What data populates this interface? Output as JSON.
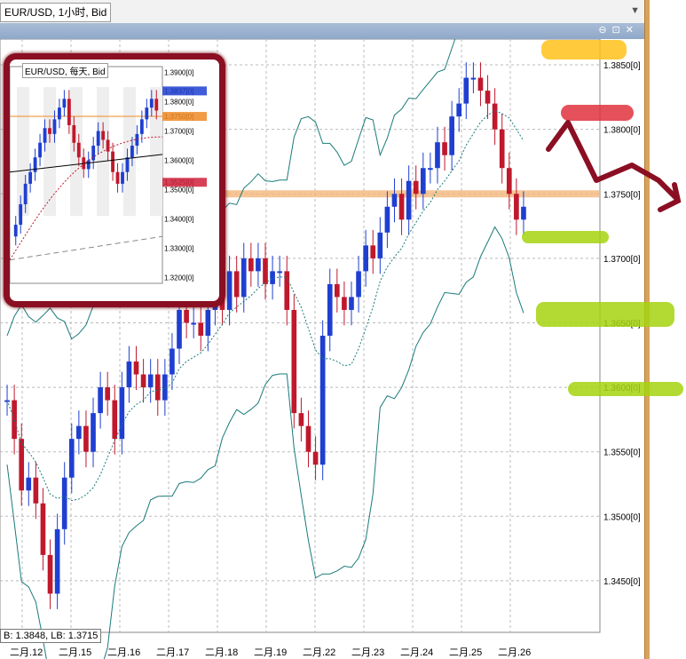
{
  "window": {
    "symbol_tab": "EUR/USD, 1小时, Bid"
  },
  "status": {
    "ohlc_label": "B: 1.3848, LB: 1.3715"
  },
  "colors": {
    "bull": "#1f3fd1",
    "bear": "#c0182c",
    "band": "#1a7a7a",
    "orange_level": "#f3b77a",
    "accent_red": "#8b0f23",
    "yellow": "#ffc21a",
    "green": "#a4d40f"
  },
  "chart_data": [
    {
      "type": "candlestick",
      "title": "EUR/USD, 1小时, Bid",
      "x_tick_labels": [
        "二月.12",
        "二月.15",
        "二月.16",
        "二月.17",
        "二月.18",
        "二月.19",
        "二月.22",
        "二月.23",
        "二月.24",
        "二月.25",
        "二月.26"
      ],
      "y_tick_labels": [
        "1.3850[0]",
        "1.3800[0]",
        "1.3750[0]",
        "1.3700[0]",
        "1.3650[0]",
        "1.3600[0]",
        "1.3550[0]",
        "1.3500[0]",
        "1.3450[0]"
      ],
      "ylim": [
        1.341,
        1.387
      ],
      "grid": true,
      "horizontal_level": 1.375,
      "close_trend": [
        1.359,
        1.356,
        1.352,
        1.353,
        1.351,
        1.347,
        1.344,
        1.349,
        1.353,
        1.356,
        1.357,
        1.355,
        1.358,
        1.36,
        1.359,
        1.356,
        1.36,
        1.362,
        1.361,
        1.36,
        1.361,
        1.359,
        1.361,
        1.363,
        1.366,
        1.365,
        1.365,
        1.364,
        1.366,
        1.368,
        1.366,
        1.369,
        1.367,
        1.37,
        1.369,
        1.37,
        1.368,
        1.369,
        1.369,
        1.366,
        1.358,
        1.357,
        1.355,
        1.354,
        1.364,
        1.368,
        1.367,
        1.366,
        1.367,
        1.369,
        1.371,
        1.37,
        1.372,
        1.374,
        1.375,
        1.373,
        1.376,
        1.375,
        1.377,
        1.377,
        1.379,
        1.378,
        1.381,
        1.382,
        1.384,
        1.384,
        1.383,
        1.382,
        1.38,
        1.377,
        1.375,
        1.373,
        1.374
      ]
    },
    {
      "type": "candlestick",
      "title": "EUR/USD, 每天, Bid",
      "y_tick_labels": [
        "1.3900[0]",
        "1.3837[0]",
        "1.3800[0]",
        "1.3750[0]",
        "1.3700[0]",
        "1.3600[0]",
        "1.3525[0]",
        "1.3500[0]",
        "1.3400[0]",
        "1.3300[0]",
        "1.3200[0]"
      ],
      "ylim": [
        1.318,
        1.392
      ],
      "price_tags": [
        1.3837,
        1.375,
        1.3525
      ],
      "closes": [
        1.338,
        1.345,
        1.352,
        1.356,
        1.361,
        1.366,
        1.371,
        1.369,
        1.374,
        1.378,
        1.381,
        1.372,
        1.366,
        1.361,
        1.357,
        1.36,
        1.365,
        1.37,
        1.367,
        1.363,
        1.356,
        1.352,
        1.356,
        1.361,
        1.365,
        1.369,
        1.374,
        1.378,
        1.381,
        1.377
      ]
    }
  ]
}
